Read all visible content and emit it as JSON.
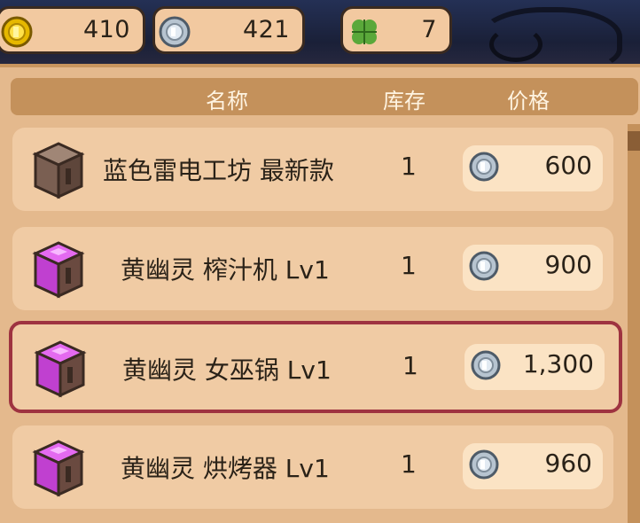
{
  "currencies": {
    "gold": {
      "icon": "gold-coin-icon",
      "value": "410"
    },
    "silver": {
      "icon": "silver-coin-icon",
      "value": "421"
    },
    "clover": {
      "icon": "clover-icon",
      "value": "7"
    }
  },
  "table": {
    "headers": {
      "name": "名称",
      "stock": "库存",
      "price": "价格"
    },
    "rows": [
      {
        "icon": "brown-crate-icon",
        "name": "蓝色雷电工坊 最新款",
        "stock": "1",
        "price_icon": "silver-coin-icon",
        "price": "600",
        "selected": false
      },
      {
        "icon": "purple-crate-icon",
        "name": "黄幽灵 榨汁机 Lv1",
        "stock": "1",
        "price_icon": "silver-coin-icon",
        "price": "900",
        "selected": false
      },
      {
        "icon": "purple-crate-icon",
        "name": "黄幽灵 女巫锅 Lv1",
        "stock": "1",
        "price_icon": "silver-coin-icon",
        "price": "1,300",
        "selected": true
      },
      {
        "icon": "purple-crate-icon",
        "name": "黄幽灵 烘烤器 Lv1",
        "stock": "1",
        "price_icon": "silver-coin-icon",
        "price": "960",
        "selected": false
      }
    ]
  },
  "colors": {
    "selected_border": "#9e3340",
    "panel": "#e4b98d",
    "header": "#c4915b"
  }
}
